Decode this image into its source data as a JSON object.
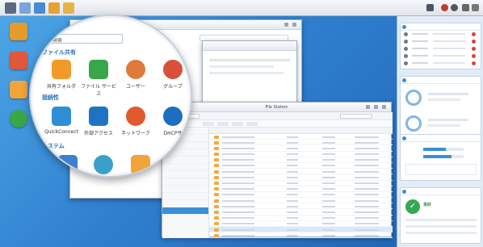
{
  "control_panel": {
    "search_value": "検索",
    "section_file_sharing": "ファイル共有",
    "section_connectivity": "接続性",
    "section_system": "システム",
    "items_row1": [
      {
        "label": "共有フォルダ",
        "icon": "shared-folder-icon",
        "color": "#f19a2a"
      },
      {
        "label": "ファイル サービス",
        "icon": "file-services-icon",
        "color": "#3aa64a"
      },
      {
        "label": "ユーザー",
        "icon": "user-icon",
        "color": "#e07a3c"
      },
      {
        "label": "グループ",
        "icon": "group-icon",
        "color": "#d8503a"
      }
    ],
    "items_row2": [
      {
        "label": "QuickConnect",
        "icon": "quickconnect-icon",
        "color": "#2e8fd8"
      },
      {
        "label": "外部アクセス",
        "icon": "external-access-icon",
        "color": "#1e74c4"
      },
      {
        "label": "ネットワーク",
        "icon": "network-icon",
        "color": "#e05a2e"
      },
      {
        "label": "DHCPサ",
        "icon": "dhcp-icon",
        "color": "#1c6ec0"
      }
    ]
  },
  "file_station": {
    "title": "File Station",
    "sidebar_items": [
      "",
      "",
      "",
      "",
      "",
      "",
      "",
      "",
      "",
      "",
      "",
      ""
    ],
    "rows": 19,
    "columns": [
      "",
      "",
      "",
      ""
    ]
  },
  "widget": {
    "resource_monitor_bars": [
      0.55,
      0.7
    ],
    "health_status": "良好"
  }
}
